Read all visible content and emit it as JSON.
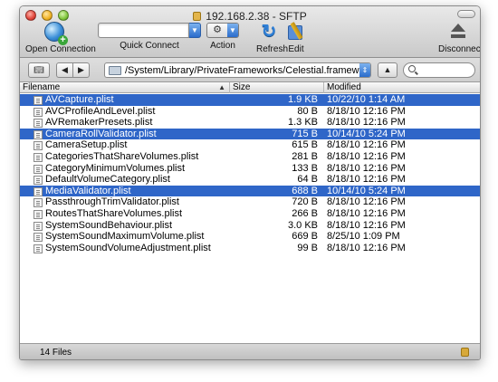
{
  "window": {
    "title": "192.168.2.38 - SFTP"
  },
  "toolbar": {
    "open_connection": "Open Connection",
    "quick_connect": "Quick Connect",
    "action": "Action",
    "refresh": "Refresh",
    "edit": "Edit",
    "disconnect": "Disconnect"
  },
  "pathbar": {
    "path": "/System/Library/PrivateFrameworks/Celestial.framework/N88"
  },
  "columns": {
    "filename": "Filename",
    "size": "Size",
    "modified": "Modified"
  },
  "files": [
    {
      "name": "AVCapture.plist",
      "size": "1.9 KB",
      "modified": "10/22/10 1:14 AM",
      "selected": true
    },
    {
      "name": "AVCProfileAndLevel.plist",
      "size": "80 B",
      "modified": "8/18/10 12:16 PM",
      "selected": false
    },
    {
      "name": "AVRemakerPresets.plist",
      "size": "1.3 KB",
      "modified": "8/18/10 12:16 PM",
      "selected": false
    },
    {
      "name": "CameraRollValidator.plist",
      "size": "715 B",
      "modified": "10/14/10 5:24 PM",
      "selected": true
    },
    {
      "name": "CameraSetup.plist",
      "size": "615 B",
      "modified": "8/18/10 12:16 PM",
      "selected": false
    },
    {
      "name": "CategoriesThatShareVolumes.plist",
      "size": "281 B",
      "modified": "8/18/10 12:16 PM",
      "selected": false
    },
    {
      "name": "CategoryMinimumVolumes.plist",
      "size": "133 B",
      "modified": "8/18/10 12:16 PM",
      "selected": false
    },
    {
      "name": "DefaultVolumeCategory.plist",
      "size": "64 B",
      "modified": "8/18/10 12:16 PM",
      "selected": false
    },
    {
      "name": "MediaValidator.plist",
      "size": "688 B",
      "modified": "10/14/10 5:24 PM",
      "selected": true
    },
    {
      "name": "PassthroughTrimValidator.plist",
      "size": "720 B",
      "modified": "8/18/10 12:16 PM",
      "selected": false
    },
    {
      "name": "RoutesThatShareVolumes.plist",
      "size": "266 B",
      "modified": "8/18/10 12:16 PM",
      "selected": false
    },
    {
      "name": "SystemSoundBehaviour.plist",
      "size": "3.0 KB",
      "modified": "8/18/10 12:16 PM",
      "selected": false
    },
    {
      "name": "SystemSoundMaximumVolume.plist",
      "size": "669 B",
      "modified": "8/25/10 1:09 PM",
      "selected": false
    },
    {
      "name": "SystemSoundVolumeAdjustment.plist",
      "size": "99 B",
      "modified": "8/18/10 12:16 PM",
      "selected": false
    }
  ],
  "status": {
    "count": "14 Files"
  },
  "icons": {
    "open_connection": "globe-plus-icon",
    "action": "gear-icon",
    "refresh": "refresh-icon",
    "edit": "edit-icon",
    "disconnect": "eject-icon",
    "bookmark": "bookmark-icon",
    "back": "back-arrow-icon",
    "forward": "forward-arrow-icon",
    "up": "up-arrow-icon",
    "search": "search-icon",
    "lock": "lock-icon"
  },
  "colors": {
    "selection": "#2f66c8",
    "popup_blue": "#2a6ccb"
  }
}
